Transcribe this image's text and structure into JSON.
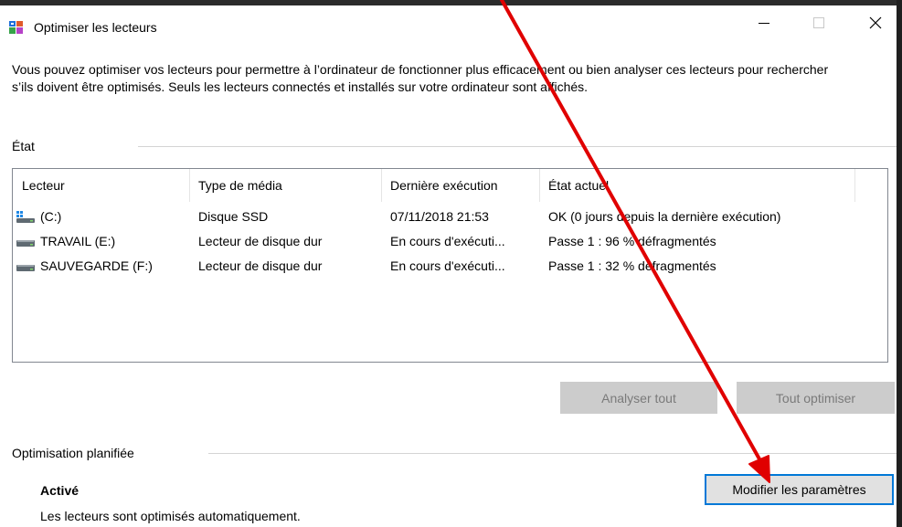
{
  "window": {
    "title": "Optimiser les lecteurs",
    "minimize_glyph": "—",
    "maximize_glyph": "☐",
    "close_glyph": "✕"
  },
  "description": "Vous pouvez optimiser vos lecteurs pour permettre à l’ordinateur de fonctionner plus efficacement ou bien analyser ces lecteurs pour rechercher s’ils doivent être optimisés. Seuls les lecteurs connectés et installés sur votre ordinateur sont affichés.",
  "status_section": {
    "label": "État"
  },
  "table": {
    "headers": [
      "Lecteur",
      "Type de média",
      "Dernière exécution",
      "État actuel"
    ],
    "rows": [
      {
        "drive": "(C:)",
        "media": "Disque SSD",
        "last_run": "07/11/2018 21:53",
        "status": "OK (0 jours depuis la dernière exécution)",
        "icon": "windows-drive-icon"
      },
      {
        "drive": "TRAVAIL (E:)",
        "media": "Lecteur de disque dur",
        "last_run": "En cours d'exécuti...",
        "status": "Passe 1 : 96 % défragmentés",
        "icon": "hard-drive-icon"
      },
      {
        "drive": "SAUVEGARDE (F:)",
        "media": "Lecteur de disque dur",
        "last_run": "En cours d'exécuti...",
        "status": "Passe 1 : 32 % défragmentés",
        "icon": "hard-drive-icon"
      }
    ]
  },
  "buttons": {
    "analyze_all": "Analyser tout",
    "optimize_all": "Tout optimiser",
    "change_settings": "Modifier les paramètres"
  },
  "scheduled": {
    "label": "Optimisation planifiée",
    "state": "Activé",
    "description": "Les lecteurs sont optimisés automatiquement."
  },
  "colors": {
    "accent": "#0078d7",
    "annotation_arrow": "#e00000",
    "disabled_button": "#cccccc"
  }
}
